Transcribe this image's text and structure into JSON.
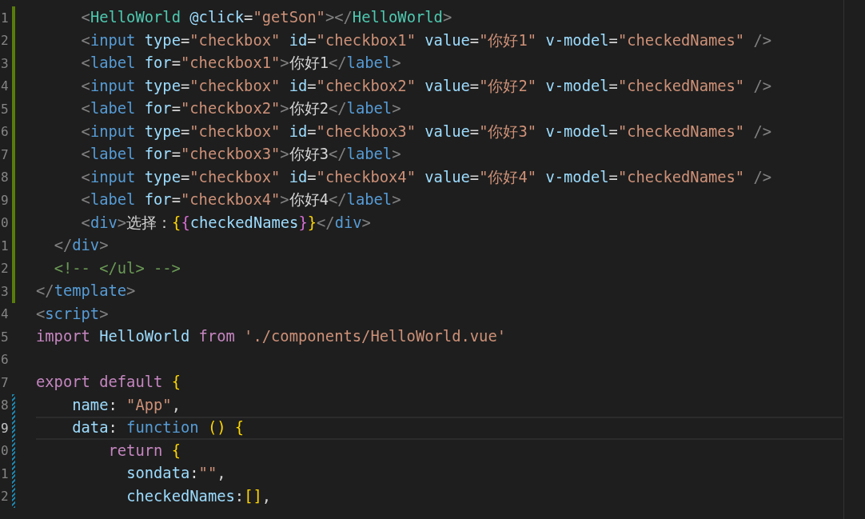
{
  "editor": {
    "lines": [
      {
        "number": "1",
        "added": true,
        "modified": false,
        "current": false,
        "text": "     <HelloWorld @click=\"getSon\"></HelloWorld>"
      },
      {
        "number": "2",
        "added": true,
        "modified": false,
        "current": false,
        "text": "     <input type=\"checkbox\" id=\"checkbox1\" value=\"你好1\" v-model=\"checkedNames\" />"
      },
      {
        "number": "3",
        "added": true,
        "modified": false,
        "current": false,
        "text": "     <label for=\"checkbox1\">你好1</label>"
      },
      {
        "number": "4",
        "added": true,
        "modified": false,
        "current": false,
        "text": "     <input type=\"checkbox\" id=\"checkbox2\" value=\"你好2\" v-model=\"checkedNames\" />"
      },
      {
        "number": "5",
        "added": true,
        "modified": false,
        "current": false,
        "text": "     <label for=\"checkbox2\">你好2</label>"
      },
      {
        "number": "6",
        "added": true,
        "modified": false,
        "current": false,
        "text": "     <input type=\"checkbox\" id=\"checkbox3\" value=\"你好3\" v-model=\"checkedNames\" />"
      },
      {
        "number": "7",
        "added": true,
        "modified": false,
        "current": false,
        "text": "     <label for=\"checkbox3\">你好3</label>"
      },
      {
        "number": "8",
        "added": true,
        "modified": false,
        "current": false,
        "text": "     <input type=\"checkbox\" id=\"checkbox4\" value=\"你好4\" v-model=\"checkedNames\" />"
      },
      {
        "number": "9",
        "added": true,
        "modified": false,
        "current": false,
        "text": "     <label for=\"checkbox4\">你好4</label>"
      },
      {
        "number": "0",
        "added": true,
        "modified": false,
        "current": false,
        "text": "     <div>选择：{{checkedNames}}</div>"
      },
      {
        "number": "1",
        "added": true,
        "modified": false,
        "current": false,
        "text": "  </div>"
      },
      {
        "number": "2",
        "added": true,
        "modified": false,
        "current": false,
        "text": "  <!-- </ul> -->"
      },
      {
        "number": "3",
        "added": true,
        "modified": false,
        "current": false,
        "text": "</template>"
      },
      {
        "number": "4",
        "added": false,
        "modified": false,
        "current": false,
        "text": "<script>"
      },
      {
        "number": "5",
        "added": false,
        "modified": false,
        "current": false,
        "text": "import HelloWorld from './components/HelloWorld.vue'"
      },
      {
        "number": "6",
        "added": false,
        "modified": false,
        "current": false
      },
      {
        "number": "7",
        "added": false,
        "modified": false,
        "current": false,
        "text": "export default {"
      },
      {
        "number": "8",
        "added": false,
        "modified": true,
        "current": false,
        "text": "    name: \"App\","
      },
      {
        "number": "9",
        "added": false,
        "modified": true,
        "current": true,
        "text": "    data: function () {"
      },
      {
        "number": "0",
        "added": false,
        "modified": true,
        "current": false,
        "text": "        return {"
      },
      {
        "number": "1",
        "added": false,
        "modified": true,
        "current": false,
        "text": "          sondata:\"\","
      },
      {
        "number": "2",
        "added": false,
        "modified": true,
        "current": false,
        "text": "          checkedNames:[],"
      }
    ]
  }
}
